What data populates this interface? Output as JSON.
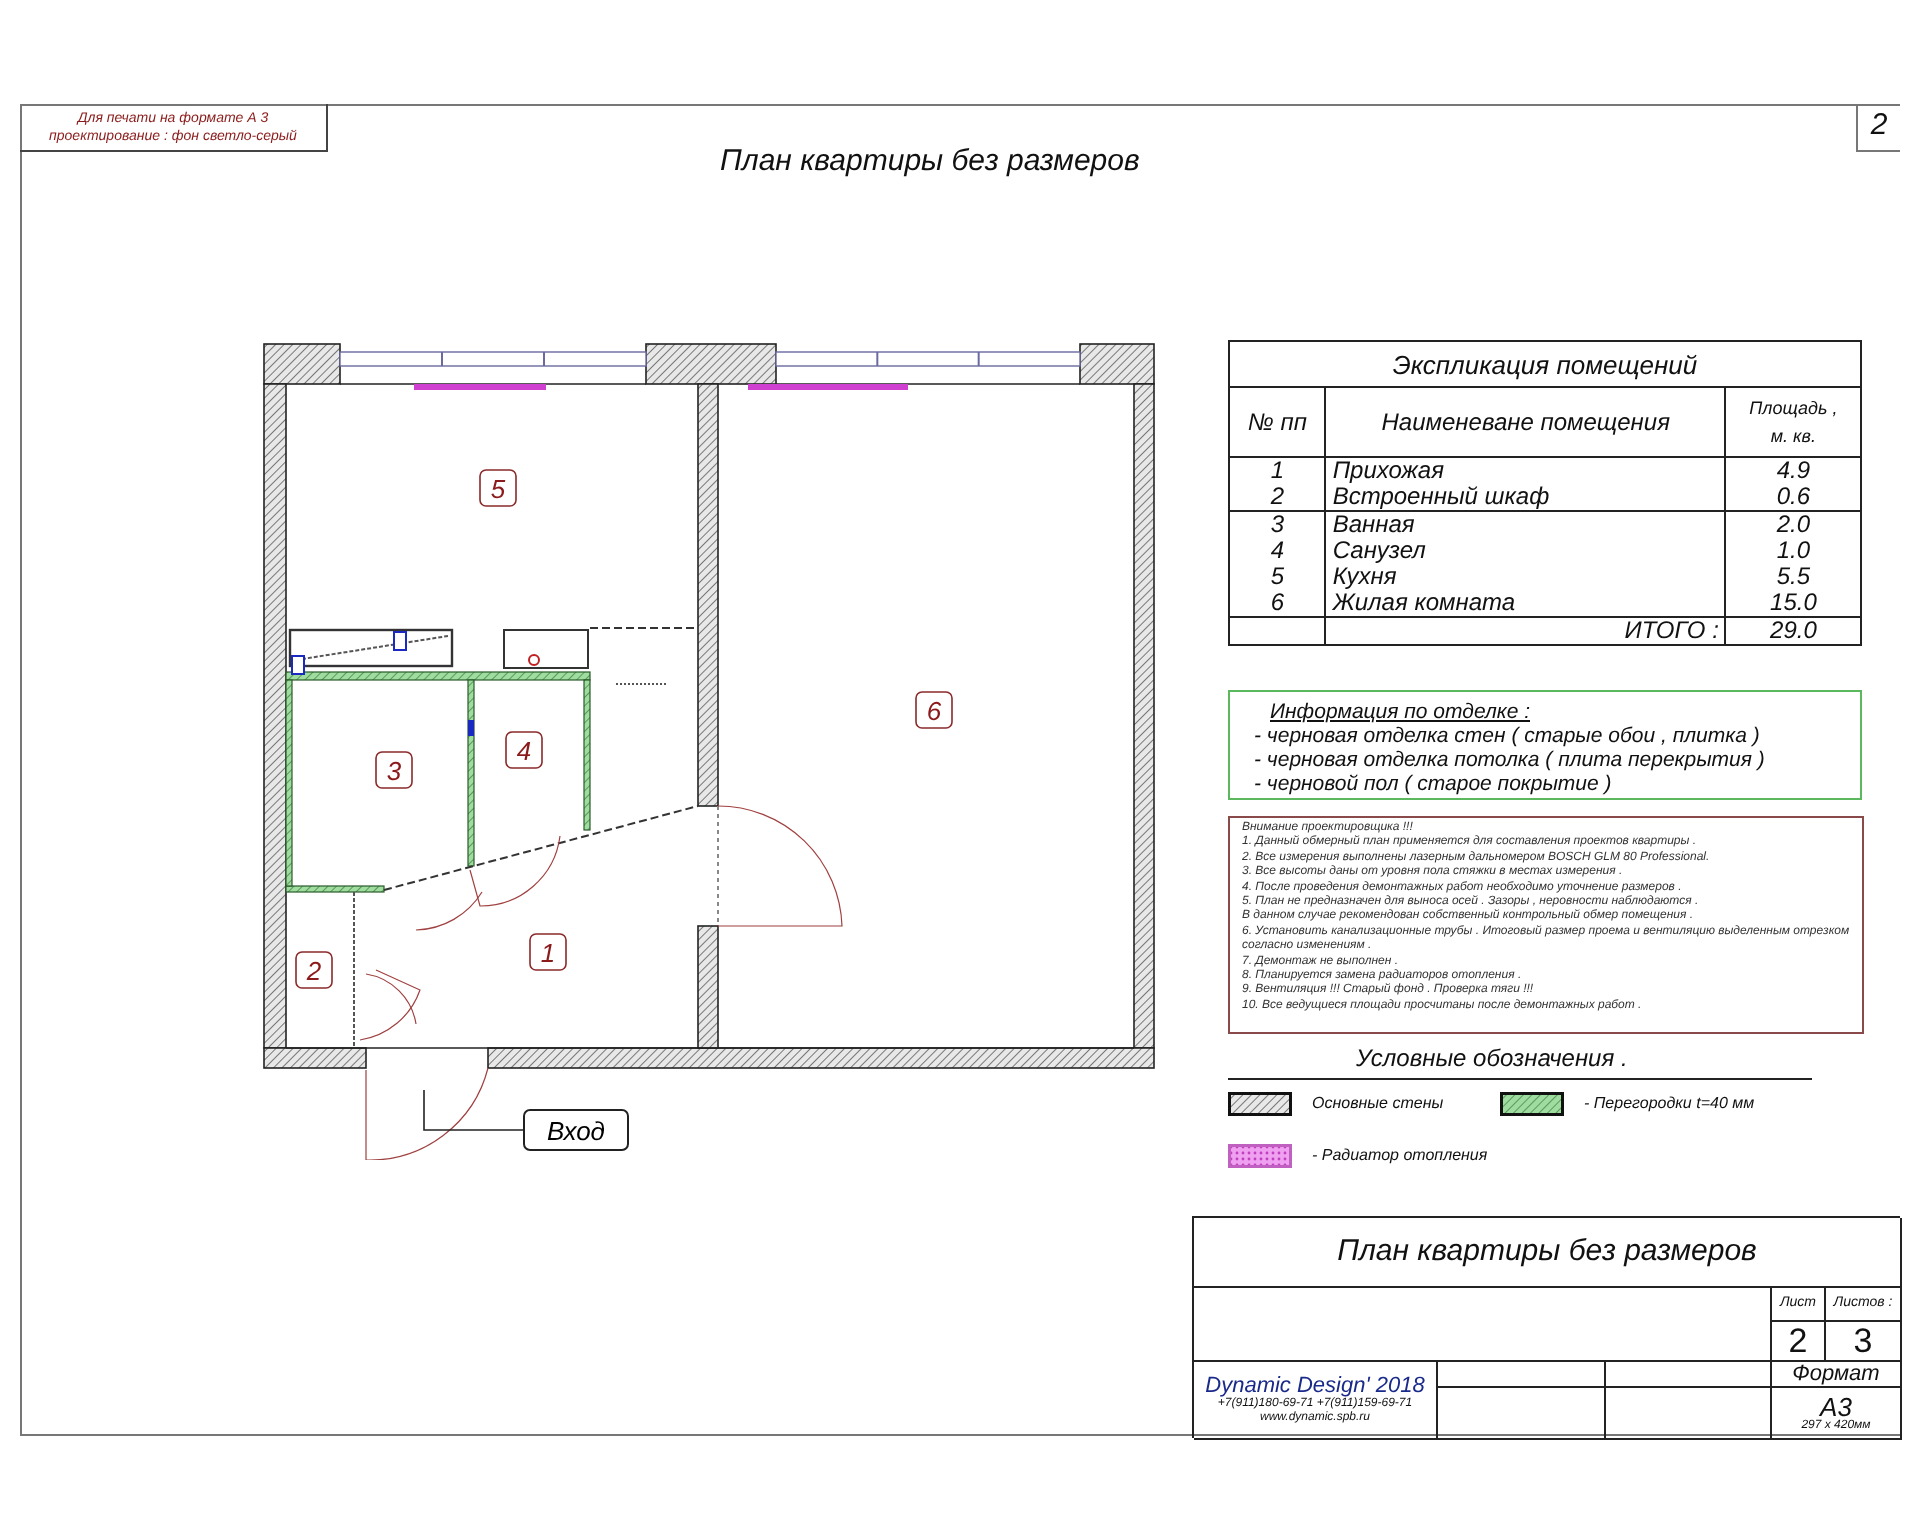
{
  "print_note": [
    "Для печати на формате А 3",
    "проектирование : фон светло-серый"
  ],
  "sheet_number": "2",
  "title": "План  квартиры без размеров",
  "plan": {
    "room_labels": [
      "5",
      "6",
      "3",
      "4",
      "2",
      "1"
    ],
    "entrance_label": "Вход"
  },
  "explication": {
    "title": "Экспликация помещений",
    "columns": [
      "№ пп",
      "Наименеване помещения",
      "Площадь ,",
      "м. кв."
    ],
    "rows": [
      {
        "number": "1",
        "name": "Прихожая",
        "area": "4.9"
      },
      {
        "number": "2",
        "name": "Встроенный шкаф",
        "area": "0.6"
      },
      {
        "number": "3",
        "name": "Ванная",
        "area": "2.0"
      },
      {
        "number": "4",
        "name": "Санузел",
        "area": "1.0"
      },
      {
        "number": "5",
        "name": "Кухня",
        "area": "5.5"
      },
      {
        "number": "6",
        "name": "Жилая комната",
        "area": "15.0"
      }
    ],
    "total_label": "ИТОГО :",
    "total": "29.0"
  },
  "finish_info": {
    "heading": "Информация по отделке :",
    "items": [
      "- черновая отделка стен  ( старые обои , плитка )",
      "- черновая отделка потолка   ( плита перекрытия )",
      "- черновой пол  ( старое покрытие )"
    ]
  },
  "notes": {
    "heading": "Внимание проектировщика !!!",
    "items": [
      "1. Данный обмерный план применяется для составления      проектов квартиры .",
      "2. Все измерения выполнены лазерным дальномером     BOSCH GLM 80 Professional.",
      "3. Все высоты даны от уровня пола стяжки в местах измерения .",
      "4. После проведения демонтажных работ необходимо уточнение размеров .",
      "5. План не предназначен для выноса осей . Зазоры , неровности наблюдаются .",
      "В данном случае рекомендован собственный контрольный обмер помещения .",
      "6. Установить канализационные трубы . Итоговый размер проема и вентиляцию выделенным отрезком согласно изменениям .",
      "7. Демонтаж не выполнен .",
      "8. Планируется замена радиаторов отопления .",
      "9. Вентиляция !!! Старый фонд . Проверка тяги !!!",
      "10. Все ведущиеся площади просчитаны после демонтажных работ ."
    ]
  },
  "legend": {
    "title": "Условные обозначения .",
    "items": [
      {
        "kind": "wall",
        "label": "Основные стены"
      },
      {
        "kind": "partition",
        "label": "- Перегородки  t=40 мм"
      },
      {
        "kind": "radiator",
        "label": "- Радиатор отопления"
      }
    ]
  },
  "title_block": {
    "title": "План  квартиры без размеров",
    "sheet_label": "Лист",
    "sheets_label": "Листов :",
    "sheet": "2",
    "sheets": "3",
    "company": "Dynamic Design' 2018",
    "phones": "+7(911)180-69-71    +7(911)159-69-71",
    "website": "www.dynamic.spb.ru",
    "format_label": "Формат",
    "format": "А3",
    "format_size": "297 х 420мм"
  }
}
